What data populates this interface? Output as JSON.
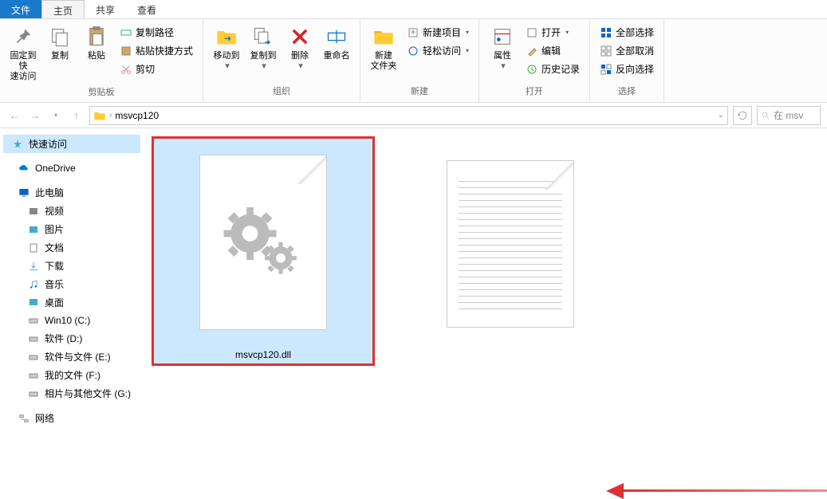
{
  "tabs": {
    "file": "文件",
    "home": "主页",
    "share": "共享",
    "view": "查看"
  },
  "ribbon": {
    "pin": "固定到快\n速访问",
    "copy": "复制",
    "paste": "粘贴",
    "copypath": "复制路径",
    "pasteshortcut": "粘贴快捷方式",
    "cut": "剪切",
    "g1": "剪贴板",
    "moveto": "移动到",
    "copyto": "复制到",
    "delete": "删除",
    "rename": "重命名",
    "g2": "组织",
    "newfolder": "新建\n文件夹",
    "newitem": "新建项目",
    "easyaccess": "轻松访问",
    "g3": "新建",
    "properties": "属性",
    "open": "打开",
    "edit": "编辑",
    "history": "历史记录",
    "g4": "打开",
    "selectall": "全部选择",
    "selectnone": "全部取消",
    "invertsel": "反向选择",
    "g5": "选择"
  },
  "address": {
    "folder": "msvcp120"
  },
  "search": {
    "placeholder": "在 msv"
  },
  "sidebar": {
    "quick": "快速访问",
    "onedrive": "OneDrive",
    "thispc": "此电脑",
    "videos": "视频",
    "pictures": "图片",
    "documents": "文档",
    "downloads": "下载",
    "music": "音乐",
    "desktop": "桌面",
    "win10": "Win10 (C:)",
    "soft_d": "软件 (D:)",
    "soft_files_e": "软件与文件 (E:)",
    "my_files_f": "我的文件 (F:)",
    "photos_g": "相片与其他文件 (G:)",
    "network": "网络"
  },
  "files": {
    "selected": "msvcp120.dll"
  }
}
